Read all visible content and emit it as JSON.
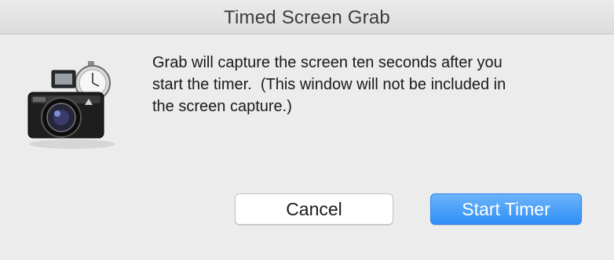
{
  "window": {
    "title": "Timed Screen Grab"
  },
  "icon": {
    "name": "camera-stopwatch-icon"
  },
  "message": {
    "lines": [
      "Grab will capture the screen ten seconds after you",
      "start the timer.  (This window will not be included in",
      "the screen capture.)"
    ]
  },
  "buttons": {
    "cancel_label": "Cancel",
    "start_label": "Start Timer"
  },
  "colors": {
    "accent": "#2f8ff6",
    "background": "#ececec"
  }
}
